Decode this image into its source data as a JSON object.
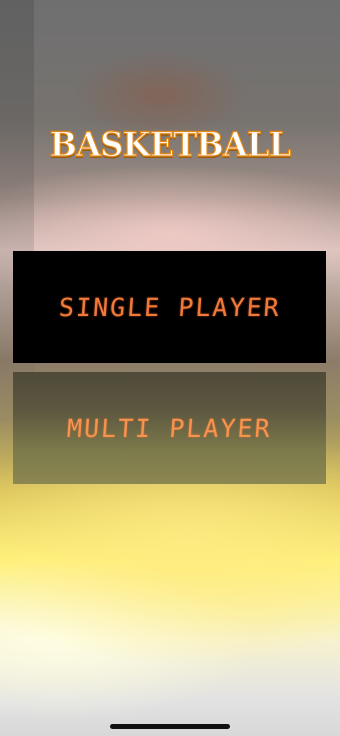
{
  "logo": {
    "text": "BASKETBALL"
  },
  "menu": {
    "single_player_label": "SINGLE PLAYER",
    "multi_player_label": "MULTI PLAYER"
  },
  "colors": {
    "label_orange": "#f17a3a",
    "logo_outline": "#e48a1a",
    "single_button_bg": "#000000"
  }
}
